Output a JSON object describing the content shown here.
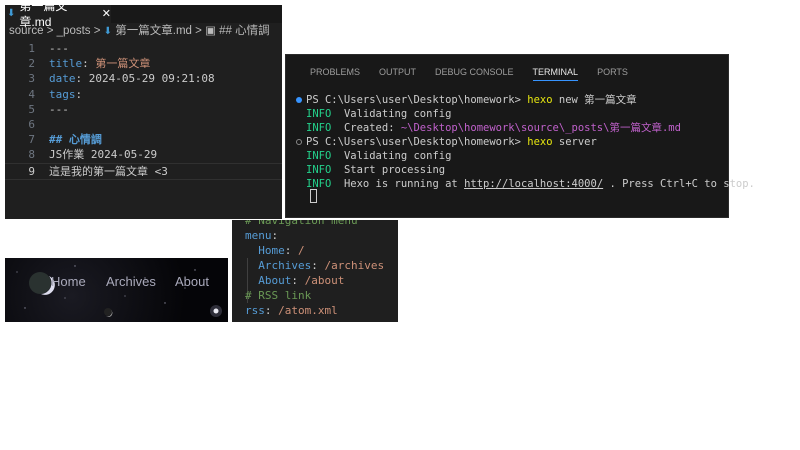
{
  "editor": {
    "tab_label": "第一篇文章.md",
    "close": "✕",
    "breadcrumb": [
      "source",
      ">",
      "_posts",
      ">",
      "第一篇文章.md",
      ">",
      "## 心情調"
    ],
    "lines": [
      {
        "n": "1",
        "parts": [
          {
            "c": "",
            "t": "---"
          }
        ]
      },
      {
        "n": "2",
        "parts": [
          {
            "c": "key",
            "t": "title"
          },
          {
            "c": "",
            "t": ": "
          },
          {
            "c": "str",
            "t": "第一篇文章"
          }
        ]
      },
      {
        "n": "3",
        "parts": [
          {
            "c": "key",
            "t": "date"
          },
          {
            "c": "",
            "t": ": 2024-05-29 09:21:08"
          }
        ]
      },
      {
        "n": "4",
        "parts": [
          {
            "c": "key",
            "t": "tags"
          },
          {
            "c": "",
            "t": ":"
          }
        ]
      },
      {
        "n": "5",
        "parts": [
          {
            "c": "",
            "t": "---"
          }
        ]
      },
      {
        "n": "6",
        "parts": []
      },
      {
        "n": "7",
        "parts": [
          {
            "c": "hd",
            "t": "## 心情調"
          }
        ]
      },
      {
        "n": "8",
        "parts": [
          {
            "c": "",
            "t": "JS作業 2024-05-29"
          }
        ]
      },
      {
        "n": "9",
        "parts": [
          {
            "c": "",
            "t": "這是我的第一篇文章 <3"
          }
        ]
      }
    ]
  },
  "terminal": {
    "tabs": [
      "PROBLEMS",
      "OUTPUT",
      "DEBUG CONSOLE",
      "TERMINAL",
      "PORTS"
    ],
    "active_tab": "TERMINAL",
    "lines": [
      {
        "dot": "#3794ff",
        "parts": [
          {
            "c": "",
            "t": "PS C:\\Users\\user\\Desktop\\homework> "
          },
          {
            "c": "y",
            "t": "hexo"
          },
          {
            "c": "",
            "t": " new 第一篇文章"
          }
        ]
      },
      {
        "parts": [
          {
            "c": "info",
            "t": "INFO"
          },
          {
            "c": "",
            "t": "  Validating config"
          }
        ]
      },
      {
        "parts": [
          {
            "c": "info",
            "t": "INFO"
          },
          {
            "c": "",
            "t": "  Created: "
          },
          {
            "c": "p",
            "t": "~\\Desktop\\homework\\source\\_posts\\第一篇文章.md"
          }
        ]
      },
      {
        "dot": "#888",
        "parts": [
          {
            "c": "",
            "t": "PS C:\\Users\\user\\Desktop\\homework> "
          },
          {
            "c": "y",
            "t": "hexo"
          },
          {
            "c": "",
            "t": " server"
          }
        ]
      },
      {
        "parts": [
          {
            "c": "info",
            "t": "INFO"
          },
          {
            "c": "",
            "t": "  Validating config"
          }
        ]
      },
      {
        "parts": [
          {
            "c": "info",
            "t": "INFO"
          },
          {
            "c": "",
            "t": "  Start processing"
          }
        ]
      },
      {
        "parts": [
          {
            "c": "info",
            "t": "INFO"
          },
          {
            "c": "",
            "t": "  Hexo is running at "
          },
          {
            "c": "u",
            "t": "http://localhost:4000/"
          },
          {
            "c": "",
            "t": " . Press Ctrl+C to stop."
          }
        ]
      }
    ]
  },
  "site_nav": {
    "items": [
      "Home",
      "Archives",
      "About"
    ]
  },
  "yaml": {
    "lines": [
      [
        {
          "c": "cm",
          "t": "# Navigation menu"
        }
      ],
      [
        {
          "c": "key",
          "t": "menu"
        },
        {
          "c": "",
          "t": ":"
        }
      ],
      [
        {
          "c": "",
          "t": "  "
        },
        {
          "c": "key",
          "t": "Home"
        },
        {
          "c": "",
          "t": ": "
        },
        {
          "c": "str",
          "t": "/"
        }
      ],
      [
        {
          "c": "",
          "t": "  "
        },
        {
          "c": "key",
          "t": "Archives"
        },
        {
          "c": "",
          "t": ": "
        },
        {
          "c": "str",
          "t": "/archives"
        }
      ],
      [
        {
          "c": "",
          "t": "  "
        },
        {
          "c": "key",
          "t": "About"
        },
        {
          "c": "",
          "t": ": "
        },
        {
          "c": "str",
          "t": "/about"
        }
      ],
      [
        {
          "c": "cm",
          "t": "# RSS link"
        }
      ],
      [
        {
          "c": "key",
          "t": "rss"
        },
        {
          "c": "",
          "t": ": "
        },
        {
          "c": "str",
          "t": "/atom.xml"
        }
      ]
    ]
  }
}
